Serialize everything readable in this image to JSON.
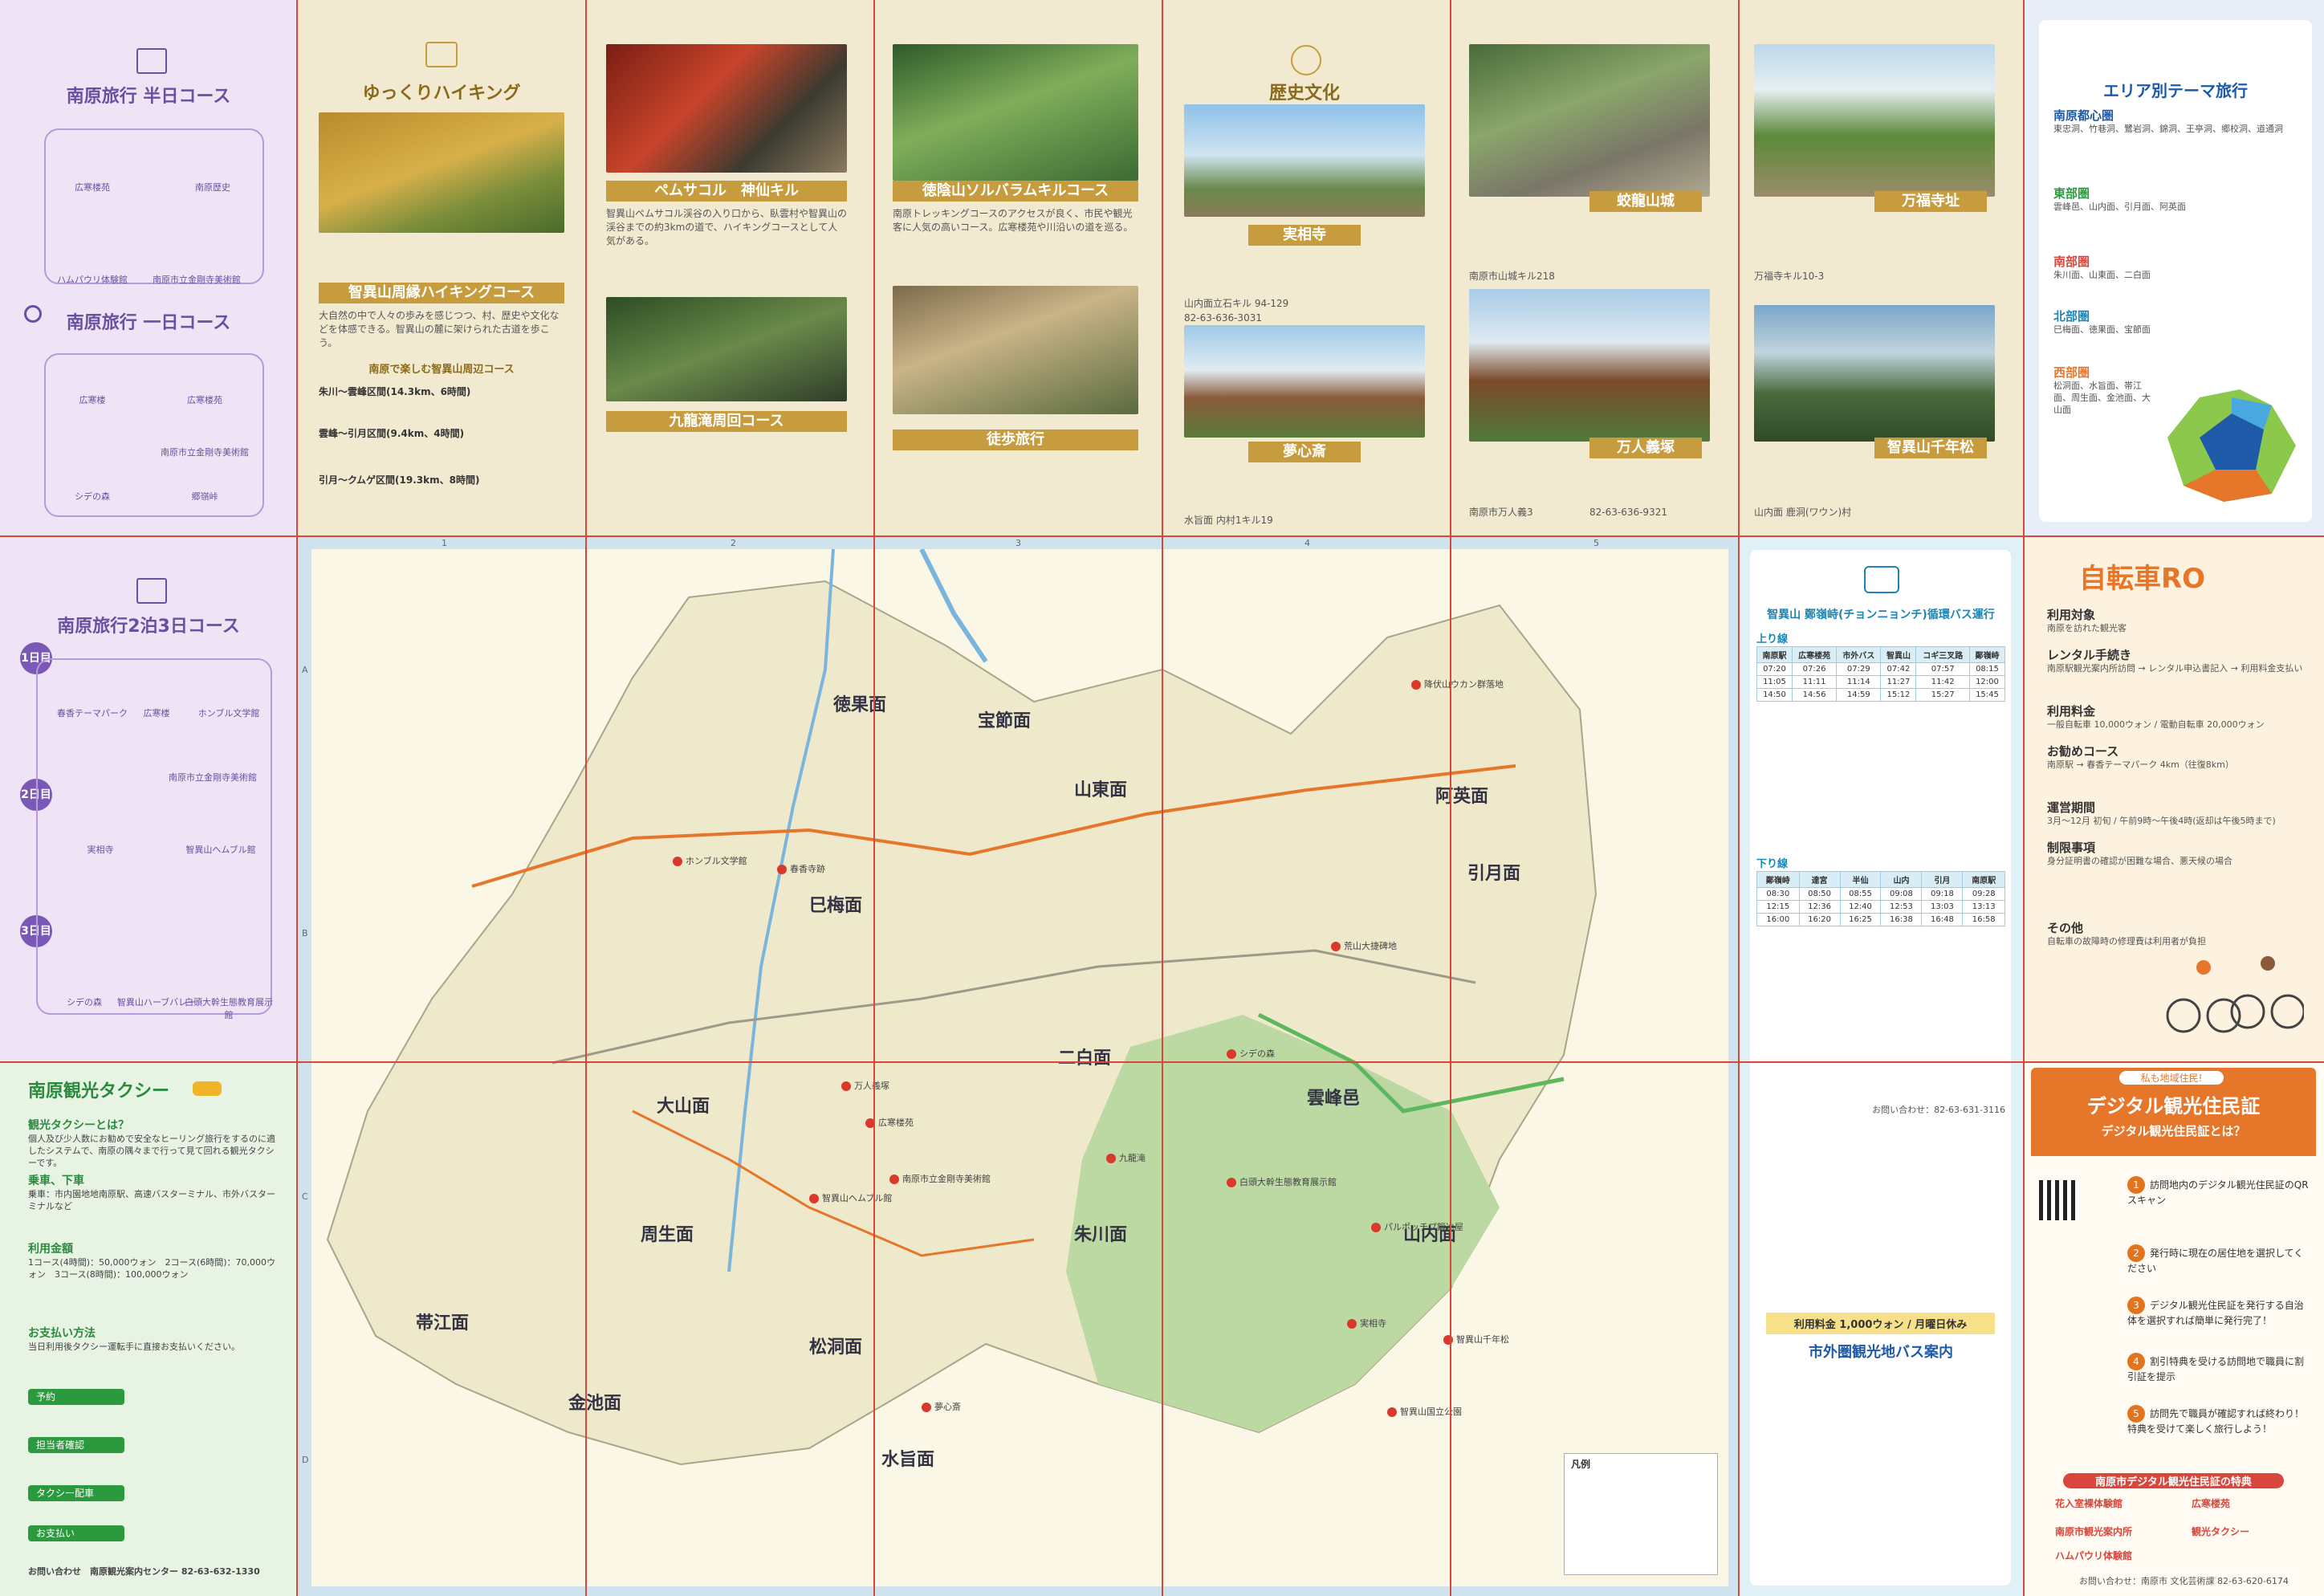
{
  "courses": {
    "half_day_title": "南原旅行 半日コース",
    "one_day_title": "南原旅行 一日コース",
    "two_night_title": "南原旅行2泊3日コース",
    "half_day_stops": [
      "広寒楼苑",
      "南原歴史",
      "ハムパウリ体験館",
      "南原市立金剛寺美術館",
      "広寒楼苑"
    ],
    "one_day_stops": [
      "広寒楼",
      "広寒楼苑",
      "南原市立金剛寺美術館",
      "シデの森",
      "郷嶺峠"
    ],
    "day_labels": [
      "1日目",
      "2日目",
      "3日目"
    ],
    "two_night_stops": [
      "春香テーマパーク",
      "広寒楼",
      "ホンブル文学館",
      "南原市立金剛寺美術館",
      "智異山ヘムブル館",
      "実相寺",
      "シデの森",
      "智異山ハーブバレー",
      "白頭大幹生態教育展示館"
    ]
  },
  "hiking": {
    "header": "ゆっくりハイキング",
    "band1": "智異山周縁ハイキングコース",
    "sub1": "南原で楽しむ智異山周辺コース",
    "text1": "大自然の中で人々の歩みを感じつつ、村、歴史や文化などを体感できる。智異山の麓に架けられた古道を歩こう。",
    "routes": [
      "朱川～雲峰区間(14.3km、6時間)",
      "雲峰～引月区間(9.4km、4時間)",
      "引月～クムゲ区間(19.3km、8時間)"
    ]
  },
  "baem": {
    "band": "ペムサコル　神仙キル",
    "band2": "九龍滝周回コース",
    "text": "智異山ペムサコル渓谷の入り口から、臥雲村や智異山の渓谷までの約3kmの道で、ハイキングコースとして人気がある。"
  },
  "deokeum": {
    "band": "徳陰山ソルバラムキルコース",
    "band2": "徒歩旅行",
    "text": "南原トレッキングコースのアクセスが良く、市民や観光客に人気の高いコース。広寒楼苑や川沿いの道を巡る。"
  },
  "history": {
    "header": "歴史文化",
    "sites": [
      {
        "name": "実相寺",
        "addr": "山内面立石キル 94-129",
        "tel": "82-63-636-3031"
      },
      {
        "name": "夢心斎",
        "addr": "水旨面 内村1キル19",
        "tel": ""
      },
      {
        "name": "蛟龍山城",
        "addr": "南原市山城キル218",
        "tel": ""
      },
      {
        "name": "万人義塚",
        "addr": "南原市万人義3",
        "tel": "82-63-636-9321"
      },
      {
        "name": "万福寺址",
        "addr": "万福寺キル10-3",
        "tel": ""
      },
      {
        "name": "智異山千年松",
        "addr": "山内面 鹿洞(ワウン)村",
        "tel": ""
      }
    ]
  },
  "area_theme": {
    "title": "エリア別テーマ旅行",
    "sections": [
      {
        "name": "南原都心圏",
        "text": "東忠洞、竹巷洞、鷺岩洞、錦洞、王亭洞、郷校洞、道通洞"
      },
      {
        "name": "東部圏",
        "text": "雲峰邑、山内面、引月面、阿英面"
      },
      {
        "name": "南部圏",
        "text": "朱川面、山東面、二白面"
      },
      {
        "name": "北部圏",
        "text": "巳梅面、徳果面、宝節面"
      },
      {
        "name": "西部圏",
        "text": "松洞面、水旨面、帯江面、周生面、金池面、大山面"
      }
    ]
  },
  "map": {
    "districts": [
      "徳果面",
      "宝節面",
      "山東面",
      "阿英面",
      "引月面",
      "巳梅面",
      "二白面",
      "雲峰邑",
      "大山面",
      "周生面",
      "朱川面",
      "山内面",
      "帯江面",
      "金池面",
      "松洞面",
      "水旨面"
    ],
    "pois": [
      "降伏山ウカン群落地",
      "ホンブル文学館",
      "春香寺跡",
      "万人義塚",
      "広寒楼苑",
      "南原市立金剛寺美術館",
      "智異山ヘムブル館",
      "九龍滝",
      "シデの森",
      "夢心斎",
      "実相寺",
      "荒山大捷碑地",
      "パルポッチプ鍛冶屋",
      "智異山国立公園",
      "智異山千年松",
      "白頭大幹生態教育展示館"
    ],
    "column_nums": [
      "1",
      "2",
      "3",
      "4",
      "5"
    ],
    "row_letters": [
      "A",
      "B",
      "C",
      "D"
    ],
    "legend_title": "凡例"
  },
  "taxi": {
    "title": "南原観光タクシー",
    "sections": [
      {
        "head": "観光タクシーとは？",
        "text": "個人及び少人数にお勧めで安全なヒーリング旅行をするのに適したシステムで、南原の隅々まで行って見て回れる観光タクシーです。"
      },
      {
        "head": "乗車、下車",
        "text": "乗車：市内園地地南原駅、高速バスターミナル、市外バスターミナルなど"
      },
      {
        "head": "利用金額",
        "text": "1コース(4時間)：50,000ウォン　2コース(6時間)：70,000ウォン　3コース(8時間)：100,000ウォン"
      },
      {
        "head": "お支払い方法",
        "text": "当日利用後タクシー運転手に直接お支払いください。"
      }
    ],
    "steps": [
      "予約",
      "担当者確認",
      "タクシー配車",
      "お支払い"
    ],
    "inquiry": "お問い合わせ　南原観光案内センター 82-63-632-1330"
  },
  "bus": {
    "title": "智異山 鄭嶺峙(チョンニョンチ)循環バス運行",
    "up_label": "上り線",
    "down_label": "下り線",
    "up_header": [
      "南原駅",
      "広寒楼苑",
      "市外バス",
      "智異山",
      "コギ三叉路",
      "鄭嶺峙"
    ],
    "up_rows": [
      [
        "07:20",
        "07:26",
        "07:29",
        "07:42",
        "07:57",
        "08:15"
      ],
      [
        "11:05",
        "11:11",
        "11:14",
        "11:27",
        "11:42",
        "12:00"
      ],
      [
        "14:50",
        "14:56",
        "14:59",
        "15:12",
        "15:27",
        "15:45"
      ]
    ],
    "down_header": [
      "鄭嶺峙",
      "達宮",
      "半仙",
      "山内",
      "引月",
      "南原駅"
    ],
    "down_rows": [
      [
        "08:30",
        "08:50",
        "08:55",
        "09:08",
        "09:18",
        "09:28"
      ],
      [
        "12:15",
        "12:36",
        "12:40",
        "12:53",
        "13:03",
        "13:13"
      ],
      [
        "16:00",
        "16:20",
        "16:25",
        "16:38",
        "16:48",
        "16:58"
      ]
    ],
    "inquiry": "お問い合わせ：82-63-631-3116",
    "outer_title": "市外圏観光地バス案内",
    "outer_price": "利用料金 1,000ウォン / 月曜日休み"
  },
  "bicycle": {
    "title": "自転車RO",
    "items": [
      {
        "head": "利用対象",
        "text": "南原を訪れた観光客"
      },
      {
        "head": "レンタル手続き",
        "text": "南原駅観光案内所訪問 → レンタル申込書記入 → 利用料金支払い"
      },
      {
        "head": "利用料金",
        "text": "一般自転車 10,000ウォン / 電動自転車 20,000ウォン"
      },
      {
        "head": "お勧めコース",
        "text": "南原駅 → 春香テーマパーク 4km（往復8km）"
      },
      {
        "head": "運営期間",
        "text": "3月～12月 初旬 / 午前9時～午後4時(返却は午後5時まで)"
      },
      {
        "head": "制限事項",
        "text": "身分証明書の確認が困難な場合、悪天候の場合"
      },
      {
        "head": "その他",
        "text": "自転車の故障時の修理費は利用者が負担"
      }
    ]
  },
  "digital": {
    "badge": "私も地域住民!",
    "title": "デジタル観光住民証",
    "question": "デジタル観光住民証とは？",
    "steps": [
      "訪問地内のデジタル観光住民証のQRスキャン",
      "発行時に現在の居住地を選択してください",
      "デジタル観光住民証を発行する自治体を選択すれば簡単に発行完了！",
      "割引特典を受ける訪問地で職員に割引証を提示",
      "訪問先で職員が確認すれば終わり！特典を受けて楽しく旅行しよう！"
    ],
    "benefits_title": "南原市デジタル観光住民証の特典",
    "benefits": [
      "花入室裸体験館",
      "広寒楼苑",
      "南原市観光案内所",
      "観光タクシー",
      "ハムパウリ体験館"
    ],
    "inquiry": "お問い合わせ：南原市 文化芸術課 82-63-620-6174"
  },
  "colors": {
    "purple": "#efe6f6",
    "beige": "#f2ead0",
    "green": "#e6f3e1",
    "map": "#f6f3e0",
    "orange": "#e6762a",
    "red": "#d9463b",
    "blue": "#1b86b5"
  }
}
